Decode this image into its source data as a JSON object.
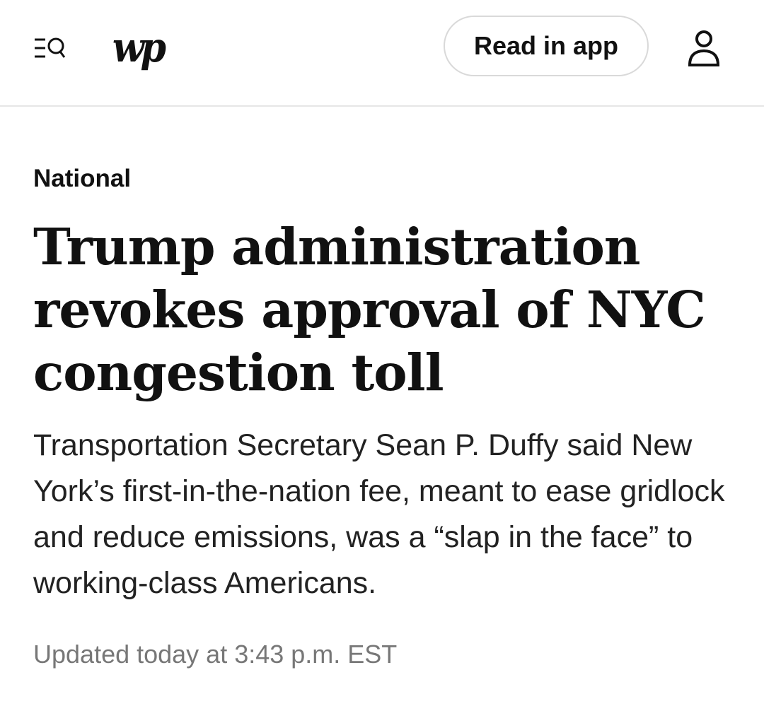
{
  "header": {
    "logo_text": "wp",
    "read_in_app_label": "Read in app",
    "menu_icon": "menu-search-icon",
    "account_icon": "user-icon"
  },
  "article": {
    "section": "National",
    "headline": "Trump administration revokes approval of NYC congestion toll",
    "dek": "Transportation Secretary Sean P. Duffy said New York’s first-in-the-nation fee, meant to ease gridlock and reduce emissions, was a “slap in the face” to working-class Americans.",
    "timestamp": "Updated today at 3:43 p.m. EST"
  },
  "colors": {
    "text": "#111111",
    "muted": "#777777",
    "divider": "#e6e6e6",
    "button_border": "#d9d9d9"
  }
}
